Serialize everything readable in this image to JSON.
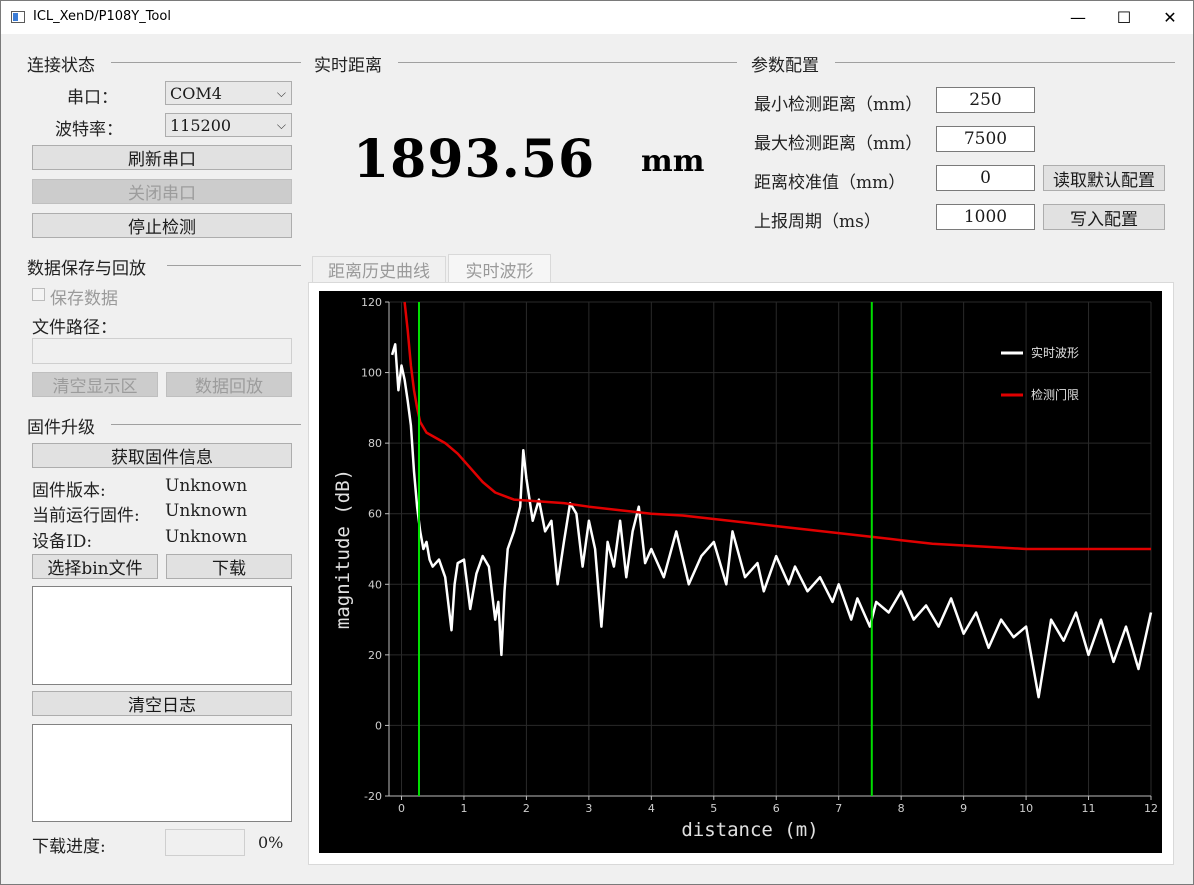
{
  "window": {
    "title": "ICL_XenD/P108Y_Tool",
    "minimize_glyph": "—",
    "maximize_glyph": "☐",
    "close_glyph": "✕"
  },
  "connection": {
    "section_title": "连接状态",
    "port_label": "串口：",
    "port_value": "COM4",
    "baud_label": "波特率：",
    "baud_value": "115200",
    "refresh_button": "刷新串口",
    "close_port_button": "关闭串口",
    "stop_button": "停止检测"
  },
  "data_save": {
    "section_title": "数据保存与回放",
    "save_checkbox_label": "保存数据",
    "save_checked": false,
    "file_path_label": "文件路径：",
    "file_path_value": "",
    "clear_display_button": "清空显示区",
    "replay_button": "数据回放"
  },
  "firmware": {
    "section_title": "固件升级",
    "get_info_button": "获取固件信息",
    "version_label": "固件版本:",
    "version_value": "Unknown",
    "running_label": "当前运行固件:",
    "running_value": "Unknown",
    "device_id_label": "设备ID:",
    "device_id_value": "Unknown",
    "select_bin_button": "选择bin文件",
    "download_button": "下载",
    "clear_log_button": "清空日志",
    "progress_label": "下载进度:",
    "progress_percent": "0%",
    "progress_fraction": 0
  },
  "realtime": {
    "section_title": "实时距离",
    "distance_value": "1893.56",
    "distance_unit": "mm"
  },
  "params": {
    "section_title": "参数配置",
    "min_label": "最小检测距离（mm）",
    "min_value": "250",
    "max_label": "最大检测距离（mm）",
    "max_value": "7500",
    "calib_label": "距离校准值（mm）",
    "calib_value": "0",
    "period_label": "上报周期（ms）",
    "period_value": "1000",
    "read_default_button": "读取默认配置",
    "write_button": "写入配置"
  },
  "tabs": [
    {
      "label": "距离历史曲线",
      "active": false
    },
    {
      "label": "实时波形",
      "active": true
    }
  ],
  "chart_data": {
    "type": "line",
    "xlabel": "distance (m)",
    "ylabel": "magnitude (dB)",
    "xlim": [
      -0.2,
      12
    ],
    "ylim": [
      -20,
      120
    ],
    "xticks": [
      0,
      1,
      2,
      3,
      4,
      5,
      6,
      7,
      8,
      9,
      10,
      11,
      12
    ],
    "yticks": [
      -20,
      0,
      20,
      40,
      60,
      80,
      100,
      120
    ],
    "grid": true,
    "background": "#000000",
    "legend_position": "top-right",
    "series": [
      {
        "name": "实时波形",
        "color": "#ffffff",
        "x": [
          -0.15,
          -0.1,
          -0.05,
          0,
          0.05,
          0.1,
          0.15,
          0.2,
          0.25,
          0.3,
          0.35,
          0.4,
          0.45,
          0.5,
          0.6,
          0.7,
          0.8,
          0.85,
          0.9,
          1.0,
          1.1,
          1.2,
          1.3,
          1.4,
          1.5,
          1.55,
          1.6,
          1.65,
          1.7,
          1.8,
          1.9,
          1.95,
          2.0,
          2.1,
          2.2,
          2.3,
          2.4,
          2.5,
          2.6,
          2.7,
          2.8,
          2.9,
          3.0,
          3.1,
          3.2,
          3.3,
          3.4,
          3.5,
          3.6,
          3.7,
          3.8,
          3.9,
          4.0,
          4.2,
          4.4,
          4.6,
          4.8,
          5.0,
          5.2,
          5.3,
          5.5,
          5.7,
          5.8,
          6.0,
          6.2,
          6.3,
          6.5,
          6.7,
          6.9,
          7.0,
          7.2,
          7.3,
          7.5,
          7.6,
          7.8,
          8.0,
          8.2,
          8.4,
          8.6,
          8.8,
          9.0,
          9.2,
          9.4,
          9.6,
          9.8,
          10.0,
          10.2,
          10.4,
          10.6,
          10.8,
          11.0,
          11.2,
          11.4,
          11.6,
          11.8,
          12.0
        ],
        "y": [
          105,
          108,
          95,
          102,
          98,
          92,
          85,
          72,
          62,
          55,
          50,
          52,
          47,
          45,
          47,
          42,
          27,
          40,
          46,
          47,
          33,
          43,
          48,
          45,
          30,
          35,
          20,
          38,
          50,
          55,
          62,
          78,
          70,
          58,
          64,
          55,
          58,
          40,
          52,
          63,
          60,
          45,
          58,
          50,
          28,
          52,
          45,
          58,
          42,
          55,
          62,
          46,
          50,
          42,
          55,
          40,
          48,
          52,
          40,
          55,
          42,
          46,
          38,
          48,
          40,
          45,
          38,
          42,
          35,
          40,
          30,
          36,
          28,
          35,
          32,
          38,
          30,
          34,
          28,
          36,
          26,
          32,
          22,
          30,
          25,
          28,
          8,
          30,
          24,
          32,
          20,
          30,
          18,
          28,
          16,
          32
        ]
      },
      {
        "name": "检测门限",
        "color": "#e00000",
        "x": [
          0.05,
          0.1,
          0.15,
          0.2,
          0.25,
          0.3,
          0.4,
          0.5,
          0.7,
          0.9,
          1.1,
          1.3,
          1.5,
          1.8,
          2.2,
          2.6,
          3.0,
          3.5,
          4.0,
          4.5,
          5.0,
          5.5,
          6.0,
          6.5,
          7.0,
          7.5,
          8.0,
          8.5,
          9.0,
          9.5,
          10.0,
          10.5,
          11.0,
          11.5,
          12.0
        ],
        "y": [
          120,
          112,
          102,
          95,
          90,
          86,
          83,
          82,
          80,
          77,
          73,
          69,
          66,
          64,
          63.5,
          63,
          62,
          61,
          60,
          59.5,
          58.5,
          57.5,
          56.5,
          55.5,
          54.5,
          53.5,
          52.5,
          51.5,
          51,
          50.5,
          50,
          50,
          50,
          50,
          50
        ]
      },
      {
        "name": "",
        "color": "#00dd00",
        "x": [
          0.28,
          0.28
        ],
        "y": [
          -20,
          120
        ]
      },
      {
        "name": "",
        "color": "#00dd00",
        "x": [
          7.53,
          7.53
        ],
        "y": [
          -20,
          120
        ]
      }
    ]
  }
}
